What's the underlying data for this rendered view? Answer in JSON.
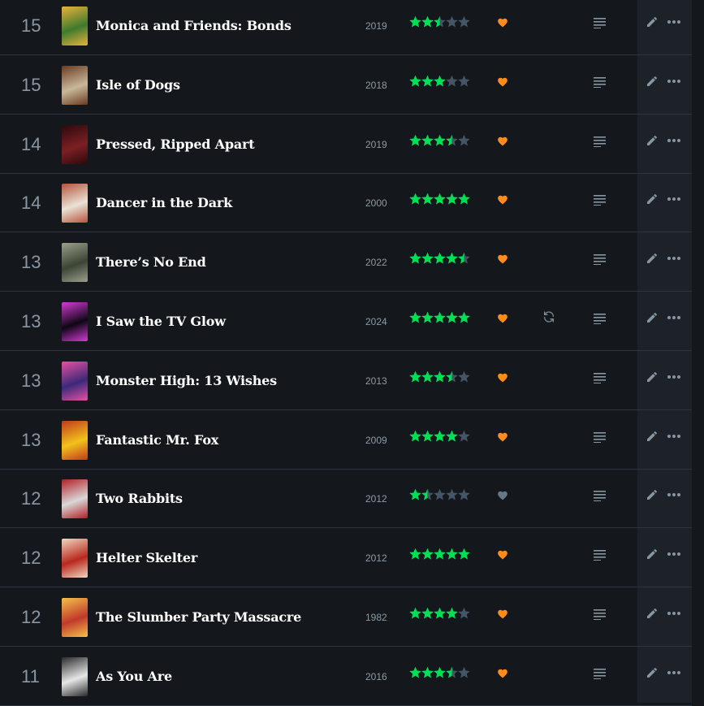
{
  "colors": {
    "background": "#14181c",
    "actions_band": "#1c2228",
    "divider": "#2c3440",
    "star_filled": "#00e054",
    "star_empty": "#456",
    "heart_liked": "#ff8c1a",
    "heart_unliked": "#667788",
    "icon": "#9ab0bf"
  },
  "films": [
    {
      "rank": "15",
      "title": "Monica and Friends: Bonds",
      "year": "2019",
      "rating": 2.5,
      "liked": true,
      "rewatch": false,
      "poster_color": "#3f7a2e",
      "poster_accent": "#e8b23a"
    },
    {
      "rank": "15",
      "title": "Isle of Dogs",
      "year": "2018",
      "rating": 3,
      "liked": true,
      "rewatch": false,
      "poster_color": "#c9b89a",
      "poster_accent": "#6a3a20"
    },
    {
      "rank": "14",
      "title": "Pressed, Ripped Apart",
      "year": "2019",
      "rating": 3.5,
      "liked": true,
      "rewatch": false,
      "poster_color": "#7d1f24",
      "poster_accent": "#2a0a0c"
    },
    {
      "rank": "14",
      "title": "Dancer in the Dark",
      "year": "2000",
      "rating": 5,
      "liked": true,
      "rewatch": false,
      "poster_color": "#e9e2d6",
      "poster_accent": "#b5533a"
    },
    {
      "rank": "13",
      "title": "There’s No End",
      "year": "2022",
      "rating": 4.5,
      "liked": true,
      "rewatch": false,
      "poster_color": "#3c4436",
      "poster_accent": "#9aa08a"
    },
    {
      "rank": "13",
      "title": "I Saw the TV Glow",
      "year": "2024",
      "rating": 5,
      "liked": true,
      "rewatch": true,
      "poster_color": "#0d0714",
      "poster_accent": "#d43ad6"
    },
    {
      "rank": "13",
      "title": "Monster High: 13 Wishes",
      "year": "2013",
      "rating": 3.5,
      "liked": true,
      "rewatch": false,
      "poster_color": "#3a2a78",
      "poster_accent": "#e94fa3"
    },
    {
      "rank": "13",
      "title": "Fantastic Mr. Fox",
      "year": "2009",
      "rating": 4,
      "liked": true,
      "rewatch": false,
      "poster_color": "#f2c21b",
      "poster_accent": "#c0391e"
    },
    {
      "rank": "12",
      "title": "Two Rabbits",
      "year": "2012",
      "rating": 1.5,
      "liked": false,
      "rewatch": false,
      "poster_color": "#d8d8d8",
      "poster_accent": "#b21f25"
    },
    {
      "rank": "12",
      "title": "Helter Skelter",
      "year": "2012",
      "rating": 5,
      "liked": true,
      "rewatch": false,
      "poster_color": "#b8281e",
      "poster_accent": "#f0d7c0"
    },
    {
      "rank": "12",
      "title": "The Slumber Party Massacre",
      "year": "1982",
      "rating": 4,
      "liked": true,
      "rewatch": false,
      "poster_color": "#c0392b",
      "poster_accent": "#f5c14a"
    },
    {
      "rank": "11",
      "title": "As You Are",
      "year": "2016",
      "rating": 3.5,
      "liked": true,
      "rewatch": false,
      "poster_color": "#e6e6e6",
      "poster_accent": "#2a2a2a"
    }
  ]
}
